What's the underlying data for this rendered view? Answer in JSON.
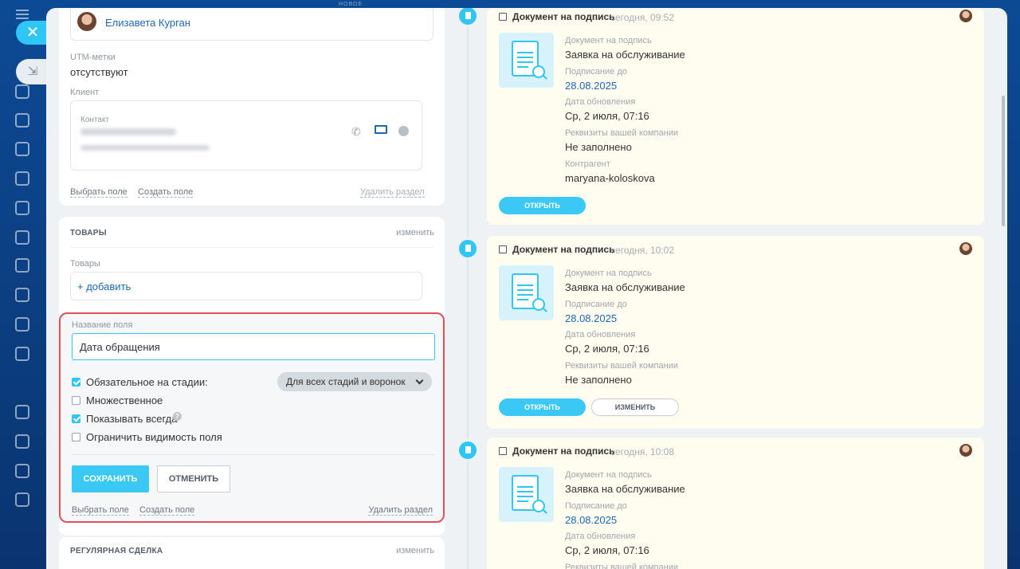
{
  "background": {
    "new_badge": "НОВОЕ"
  },
  "left": {
    "responsible_name": "Елизавета Курган",
    "utm_label": "UTM-метки",
    "utm_value": "отсутствуют",
    "client_label": "Клиент",
    "contact_label": "Контакт",
    "links": {
      "select_field": "Выбрать поле",
      "create_field": "Создать поле",
      "delete_section": "Удалить раздел"
    },
    "products_section": {
      "title": "ТОВАРЫ",
      "action": "изменить",
      "field_label": "Товары",
      "add_link": "+ добавить"
    },
    "edit_field": {
      "name_label": "Название поля",
      "name_value": "Дата обращения",
      "required_label": "Обязательное на стадии:",
      "required_checked": true,
      "stage_select": "Для всех стадий и воронок",
      "multiple_label": "Множественное",
      "multiple_checked": false,
      "show_always_label": "Показывать всегда",
      "show_always_checked": true,
      "help_glyph": "?",
      "limit_visibility_label": "Ограничить видимость поля",
      "limit_visibility_checked": false,
      "save_label": "СОХРАНИТЬ",
      "cancel_label": "ОТМЕНИТЬ"
    },
    "regular_section": {
      "title": "РЕГУЛЯРНАЯ СДЕЛКА",
      "action": "изменить"
    }
  },
  "timeline": {
    "items": [
      {
        "title": "Документ на подпись",
        "time": "сегодня, 09:52",
        "doc_type_label": "Документ на подпись",
        "doc_type_value": "Заявка на обслуживание",
        "sign_until_label": "Подписание до",
        "sign_until_value": "28.08.2025",
        "updated_label": "Дата обновления",
        "updated_value": "Ср, 2 июля, 07:16",
        "requisites_label": "Реквизиты вашей компании",
        "requisites_value": "Не заполнено",
        "counterparty_label": "Контрагент",
        "counterparty_value": "maryana-koloskova",
        "open_label": "ОТКРЫТЬ"
      },
      {
        "title": "Документ на подпись",
        "time": "сегодня, 10:02",
        "doc_type_label": "Документ на подпись",
        "doc_type_value": "Заявка на обслуживание",
        "sign_until_label": "Подписание до",
        "sign_until_value": "28.08.2025",
        "updated_label": "Дата обновления",
        "updated_value": "Ср, 2 июля, 07:16",
        "requisites_label": "Реквизиты вашей компании",
        "requisites_value": "Не заполнено",
        "open_label": "ОТКРЫТЬ",
        "edit_label": "ИЗМЕНИТЬ"
      },
      {
        "title": "Документ на подпись",
        "time": "сегодня, 10:08",
        "doc_type_label": "Документ на подпись",
        "doc_type_value": "Заявка на обслуживание",
        "sign_until_label": "Подписание до",
        "sign_until_value": "28.08.2025",
        "updated_label": "Дата обновления",
        "updated_value": "Ср, 2 июля, 07:16",
        "requisites_label": "Реквизиты вашей компании"
      }
    ]
  },
  "colors": {
    "accent": "#2fc6f6",
    "highlight_border": "#e05058",
    "link": "#2067b0",
    "card_bg": "#fefdf0"
  },
  "icons": {
    "close": "close-icon",
    "collapse": "collapse-icon",
    "call": "phone-icon",
    "mail": "mail-icon",
    "chat": "chat-icon",
    "timeline_doc": "document-icon"
  }
}
